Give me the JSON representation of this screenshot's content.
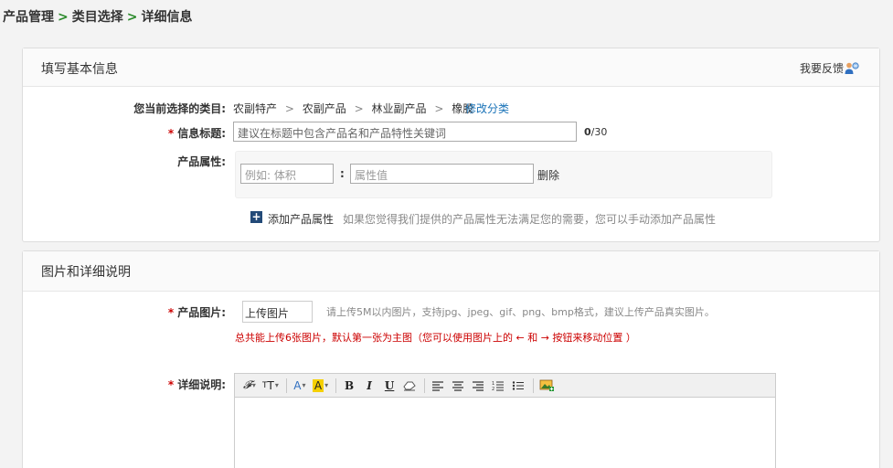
{
  "breadcrumb": {
    "items": [
      "产品管理",
      "类目选择",
      "详细信息"
    ],
    "separator": ">"
  },
  "panel1": {
    "title": "填写基本信息",
    "feedback_label": "我要反馈",
    "feedback_icon": "user-feedback-icon",
    "category": {
      "label": "您当前选择的类目:",
      "path": [
        "农副特产",
        "农副产品",
        "林业副产品",
        "橡胶"
      ],
      "path_separator": ">",
      "modify_link": "修改分类"
    },
    "title_field": {
      "required_mark": "*",
      "label": "信息标题:",
      "value": "建议在标题中包含产品名和产品特性关键词",
      "count_current": "0",
      "count_max": "/30"
    },
    "attributes": {
      "label": "产品属性:",
      "name_placeholder": "例如: 体积",
      "colon": ":",
      "value_placeholder": "属性值",
      "delete_label": "删除",
      "add_icon": "plus-icon",
      "add_label": "添加产品属性",
      "add_hint": "如果您觉得我们提供的产品属性无法满足您的需要，您可以手动添加产品属性"
    }
  },
  "panel2": {
    "title": "图片和详细说明",
    "images": {
      "required_mark": "*",
      "label": "产品图片:",
      "upload_label": "上传图片",
      "hint": "请上传5M以内图片，支持jpg、jpeg、gif、png、bmp格式，建议上传产品真实图片。",
      "warning": "总共能上传6张图片，默认第一张为主图（您可以使用图片上的 ← 和 → 按钮来移动位置 ）"
    },
    "description": {
      "required_mark": "*",
      "label": "详细说明:",
      "toolbar": [
        "font-family",
        "font-size",
        "font-color",
        "highlight-color",
        "bold",
        "italic",
        "underline",
        "eraser",
        "align-left",
        "align-center",
        "align-right",
        "ordered-list",
        "unordered-list",
        "insert-image"
      ]
    }
  },
  "colors": {
    "required": "#cc0000",
    "link": "#1a73b8",
    "breadcrumb_separator": "#2a8a2a",
    "warning": "#cc0000"
  }
}
